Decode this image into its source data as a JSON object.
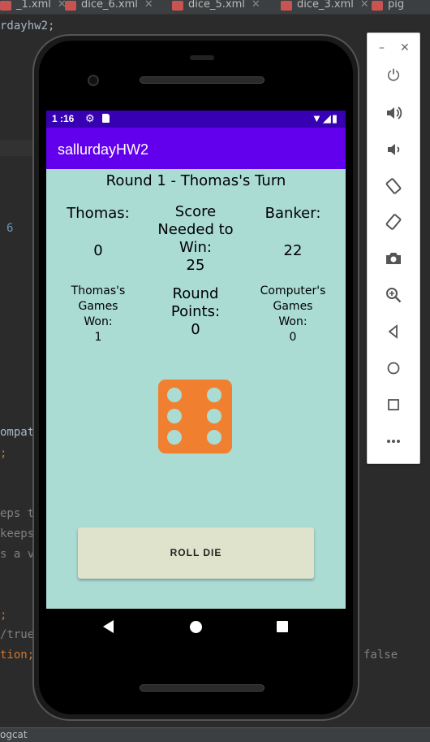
{
  "ide": {
    "tabs": [
      {
        "label": "_1.xml"
      },
      {
        "label": "dice_6.xml"
      },
      {
        "label": "dice_5.xml"
      },
      {
        "label": "dice_3.xml"
      },
      {
        "label": "pig"
      }
    ],
    "code_fragments": {
      "line1": "rdayhw2;",
      "num6": "6",
      "compat": "ompat",
      "semi1": ";",
      "keeps1": "eps t",
      "keeps2": "keeps",
      "sav": "s a v",
      "semi2": ";",
      "true": "/true",
      "tion": "tion;",
      "false": "false"
    },
    "statusbar": "ogcat"
  },
  "device": {
    "status": {
      "time": "1 :16",
      "gear_icon": "gear-icon",
      "sd_icon": "sd-card-icon",
      "right_icons": "▼◢▮"
    },
    "app_title": "sallurdayHW2",
    "round_title": "Round 1 - Thomas's Turn",
    "player": {
      "name_label": "Thomas:",
      "score": "0",
      "games_won_label_1": "Thomas's",
      "games_won_label_2": "Games",
      "games_won_label_3": "Won:",
      "games_won": "1"
    },
    "target": {
      "label_1": "Score",
      "label_2": "Needed to",
      "label_3": "Win:",
      "value": "25"
    },
    "banker": {
      "name_label": "Banker:",
      "score": "22",
      "games_won_label_1": "Computer's",
      "games_won_label_2": "Games",
      "games_won_label_3": "Won:",
      "games_won": "0"
    },
    "round": {
      "label_1": "Round",
      "label_2": "Points:",
      "value": "0"
    },
    "die": {
      "face": 6,
      "color": "#f08030",
      "pip_color": "#aadcd4"
    },
    "roll_button": "ROLL DIE",
    "colors": {
      "status_bar": "#3700b3",
      "app_bar": "#6200ee",
      "content_bg": "#aadcd4",
      "button_bg": "#dfe3cc"
    }
  },
  "emulator_toolbar": {
    "minimize": "–",
    "close": "✕",
    "buttons": [
      {
        "name": "power-icon",
        "glyph": "⏻"
      },
      {
        "name": "volume-up-icon",
        "glyph": "🔊"
      },
      {
        "name": "volume-down-icon",
        "glyph": "🔉"
      },
      {
        "name": "rotate-left-icon",
        "glyph": "⟲"
      },
      {
        "name": "rotate-right-icon",
        "glyph": "⟳"
      },
      {
        "name": "camera-icon",
        "glyph": "📷"
      },
      {
        "name": "zoom-icon",
        "glyph": "🔍"
      },
      {
        "name": "back-icon",
        "glyph": "◁"
      },
      {
        "name": "home-icon",
        "glyph": "○"
      },
      {
        "name": "overview-icon",
        "glyph": "□"
      },
      {
        "name": "more-icon",
        "glyph": "•••"
      }
    ]
  }
}
